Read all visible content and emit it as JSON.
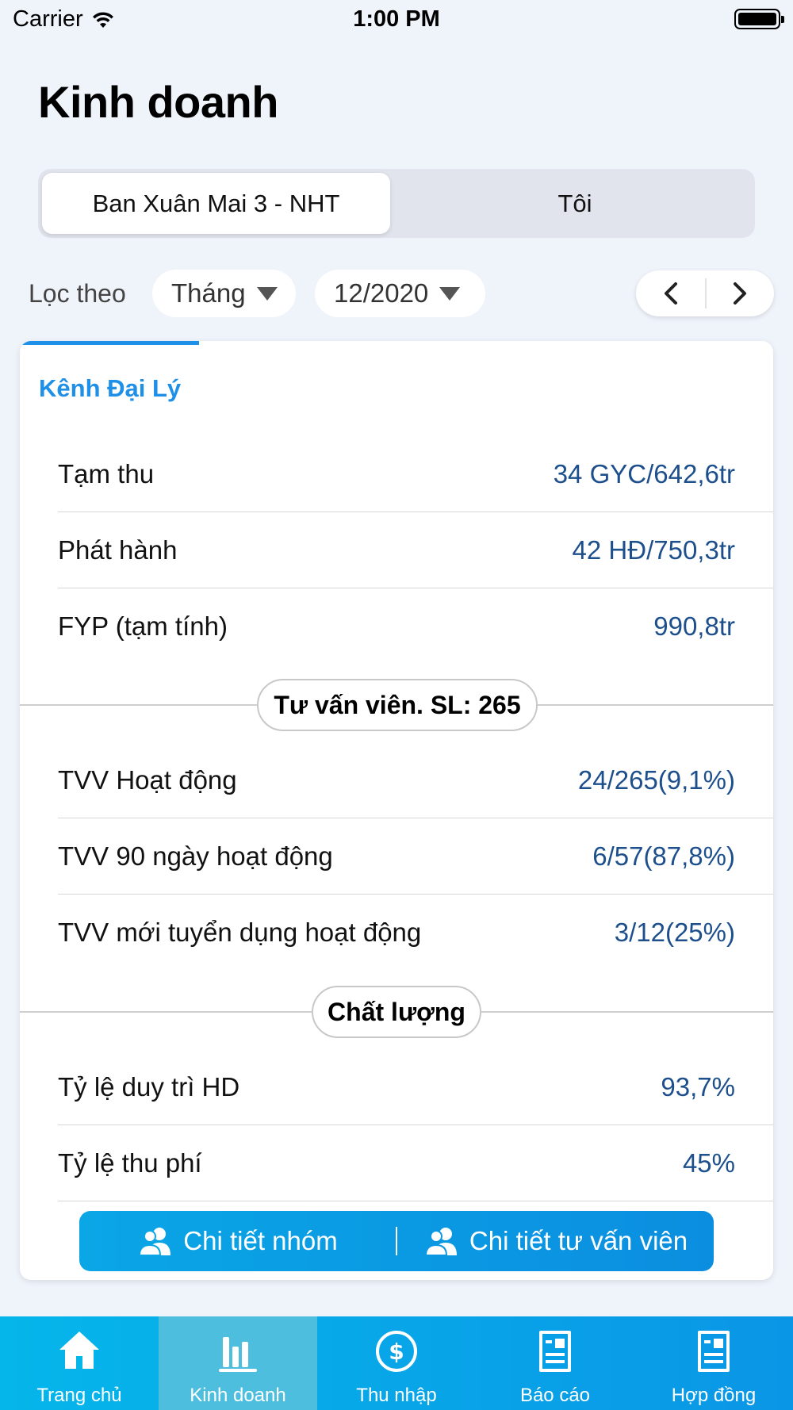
{
  "status_bar": {
    "carrier": "Carrier",
    "time": "1:00 PM"
  },
  "page_title": "Kinh doanh",
  "segments": [
    {
      "label": "Ban Xuân Mai 3 - NHT",
      "selected": true
    },
    {
      "label": "Tôi",
      "selected": false
    }
  ],
  "filter": {
    "label": "Lọc theo",
    "period_type": "Tháng",
    "period_value": "12/2020"
  },
  "card": {
    "title": "Kênh Đại Lý",
    "rows_top": [
      {
        "label": "Tạm thu",
        "value": "34 GYC/642,6tr"
      },
      {
        "label": "Phát hành",
        "value": "42 HĐ/750,3tr"
      },
      {
        "label": "FYP (tạm tính)",
        "value": "990,8tr"
      }
    ],
    "section_advisors": "Tư vấn viên. SL: 265",
    "rows_advisors": [
      {
        "label": "TVV Hoạt động",
        "value": "24/265(9,1%)"
      },
      {
        "label": "TVV 90 ngày hoạt động",
        "value": "6/57(87,8%)"
      },
      {
        "label": "TVV mới tuyển dụng hoạt động",
        "value": "3/12(25%)"
      }
    ],
    "section_quality": "Chất lượng",
    "rows_quality": [
      {
        "label": "Tỷ lệ duy trì HD",
        "value": "93,7%"
      },
      {
        "label": "Tỷ lệ thu phí",
        "value": "45%"
      }
    ],
    "actions": {
      "group_detail": "Chi tiết nhóm",
      "advisor_detail": "Chi tiết tư vấn viên"
    }
  },
  "bottom_nav": [
    {
      "label": "Trang chủ",
      "icon": "home-icon",
      "active": false
    },
    {
      "label": "Kinh doanh",
      "icon": "bar-chart-icon",
      "active": true
    },
    {
      "label": "Thu nhập",
      "icon": "dollar-icon",
      "active": false
    },
    {
      "label": "Báo cáo",
      "icon": "report-icon",
      "active": false
    },
    {
      "label": "Hợp đồng",
      "icon": "contract-icon",
      "active": false
    }
  ],
  "colors": {
    "accent": "#1e90e8",
    "value_text": "#1c4f8c",
    "nav_gradient_start": "#05b6ea",
    "nav_gradient_end": "#0a96e6",
    "background": "#eff3fa"
  }
}
